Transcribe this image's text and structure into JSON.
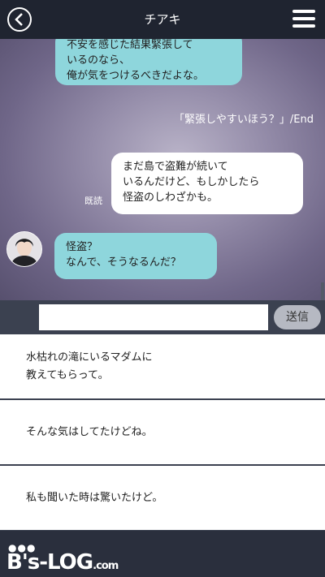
{
  "header": {
    "title": "チアキ"
  },
  "messages": [
    {
      "side": "right",
      "color": "teal",
      "text": "不安を感じた結果緊張して\nいるのなら、\n俺が気をつけるべきだよな。"
    },
    {
      "side": "right",
      "color": "white",
      "text": "まだ島で盗難が続いて\nいるんだけど、もしかしたら\n怪盗のしわざかも。"
    },
    {
      "side": "left",
      "color": "teal",
      "text": "怪盗？\nなんで、そうなるんだ？"
    }
  ],
  "end_note": "「緊張しやすいほう？」/End",
  "read_mark": "既読",
  "input": {
    "value": "",
    "send_label": "送信"
  },
  "choices": [
    "水枯れの滝にいるマダムに\n教えてもらって。",
    "そんな気はしてたけどね。",
    "私も聞いた時は驚いたけど。"
  ],
  "footer": {
    "logo_dots": "●●●",
    "logo_text": "B's-LOG",
    "logo_suffix": ".com"
  }
}
